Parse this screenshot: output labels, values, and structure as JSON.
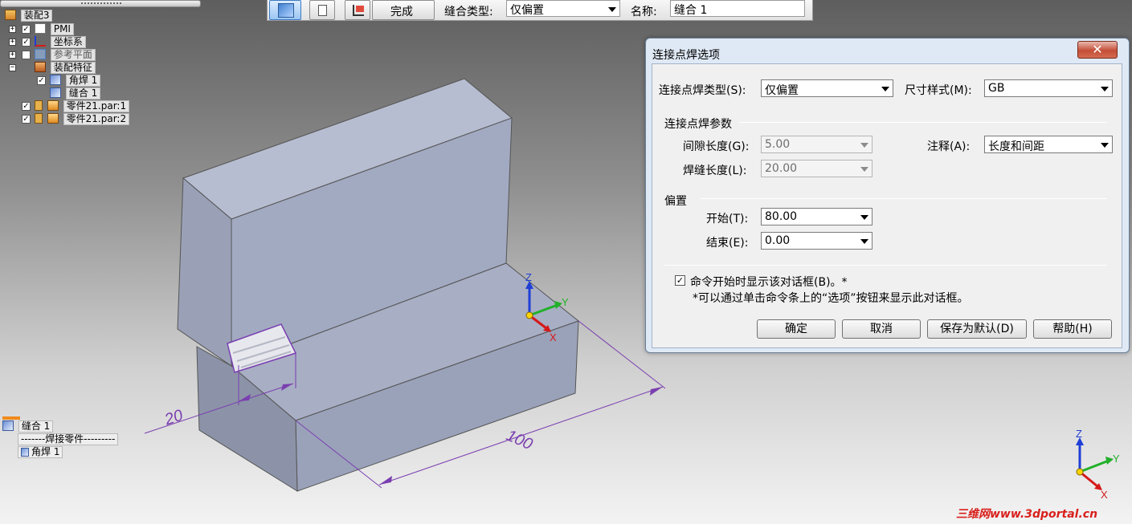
{
  "toolbar": {
    "finish_label": "完成",
    "weld_type_label": "缝合类型:",
    "weld_type_value": "仅偏置",
    "name_label": "名称:",
    "name_value": "缝合 1"
  },
  "tree": {
    "root": "装配3",
    "items": [
      {
        "label": "PMI"
      },
      {
        "label": "坐标系"
      },
      {
        "label": "参考平面"
      },
      {
        "label": "装配特征"
      },
      {
        "label": "角焊 1"
      },
      {
        "label": "缝合 1"
      },
      {
        "label": "零件21.par:1"
      },
      {
        "label": "零件21.par:2"
      }
    ]
  },
  "lower_list": {
    "title": "缝合 1",
    "separator": "-------焊接零件---------",
    "item": "角焊 1"
  },
  "dialog": {
    "title": "连接点焊选项",
    "close": "✕",
    "type_label": "连接点焊类型(S):",
    "type_value": "仅偏置",
    "dim_style_label": "尺寸样式(M):",
    "dim_style_value": "GB",
    "params_group": "连接点焊参数",
    "gap_label": "间隙长度(G):",
    "gap_value": "5.00",
    "length_label": "焊缝长度(L):",
    "length_value": "20.00",
    "annotation_label": "注释(A):",
    "annotation_value": "长度和间距",
    "offset_group": "偏置",
    "start_label": "开始(T):",
    "start_value": "80.00",
    "end_label": "结束(E):",
    "end_value": "0.00",
    "show_dialog_checkbox": "命令开始时显示该对话框(B)。*",
    "hint": "*可以通过单击命令条上的“选项”按钮来显示此对话框。",
    "ok": "确定",
    "cancel": "取消",
    "save_default": "保存为默认(D)",
    "help": "帮助(H)"
  },
  "viewport": {
    "dim_short": "20",
    "dim_long": "100",
    "axis_z": "Z",
    "axis_y": "Y",
    "axis_x": "X"
  },
  "watermark": "三维网www.3dportal.cn",
  "colors": {
    "face_front": "#a2aac2",
    "face_top": "#9ea6bd",
    "face_side": "#8c93a8",
    "dim_line": "#7a3fb0",
    "axis_z": "#1f3fd6",
    "axis_y": "#22b02a",
    "axis_x": "#d51919",
    "dialog_frame": "#dfe9f5"
  }
}
